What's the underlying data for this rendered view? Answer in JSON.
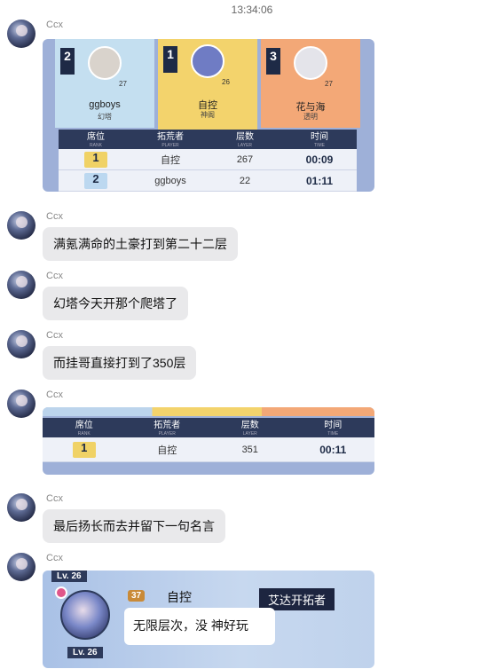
{
  "timestamp": "13:34:06",
  "sender": "Ccx",
  "card1": {
    "podium": [
      {
        "place": "2",
        "name": "ggboys",
        "guild": "幻塔",
        "level": "27"
      },
      {
        "place": "1",
        "name": "自控",
        "guild": "神阁",
        "level": "26"
      },
      {
        "place": "3",
        "name": "花与海",
        "guild": "透明",
        "level": "27"
      }
    ],
    "headers": [
      {
        "label": "席位",
        "sub": "RANK"
      },
      {
        "label": "拓荒者",
        "sub": "PLAYER"
      },
      {
        "label": "层数",
        "sub": "LAYER"
      },
      {
        "label": "时间",
        "sub": "TIME"
      }
    ],
    "rows": [
      {
        "rank": "1",
        "player": "自控",
        "layer": "267",
        "time": "00:09"
      },
      {
        "rank": "2",
        "player": "ggboys",
        "layer": "22",
        "time": "01:11"
      }
    ]
  },
  "messages": [
    "满氪满命的土豪打到第二十二层",
    "幻塔今天开那个爬塔了",
    "而挂哥直接打到了350层"
  ],
  "card2": {
    "headers": [
      {
        "label": "席位",
        "sub": "RANK"
      },
      {
        "label": "拓荒者",
        "sub": "PLAYER"
      },
      {
        "label": "层数",
        "sub": "LAYER"
      },
      {
        "label": "时间",
        "sub": "TIME"
      }
    ],
    "row": {
      "rank": "1",
      "player": "自控",
      "layer": "351",
      "time": "00:11"
    }
  },
  "message_last": "最后扬长而去并留下一句名言",
  "card3": {
    "level": "Lv. 26",
    "badge": "37",
    "name": "自控",
    "tag": "艾达开拓者",
    "quote": "无限层次，没 神好玩"
  }
}
